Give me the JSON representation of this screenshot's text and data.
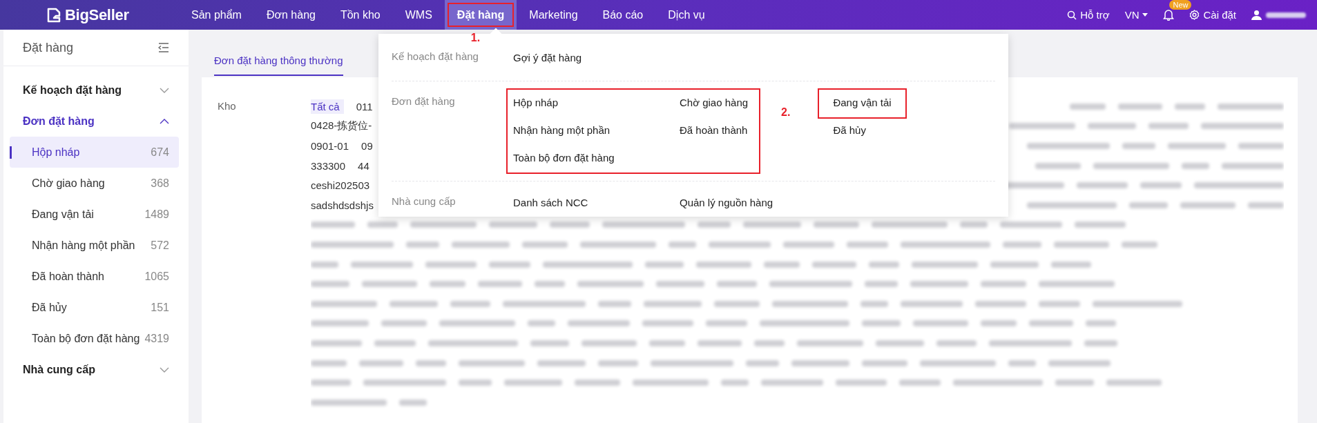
{
  "top_nav": {
    "logo": "BigSeller",
    "items": [
      {
        "label": "Sản phẩm",
        "selected": false,
        "highlighted": false
      },
      {
        "label": "Đơn hàng",
        "selected": false,
        "highlighted": false
      },
      {
        "label": "Tồn kho",
        "selected": false,
        "highlighted": false
      },
      {
        "label": "WMS",
        "selected": false,
        "highlighted": false
      },
      {
        "label": "Đặt hàng",
        "selected": true,
        "highlighted": true,
        "annotation": "1."
      },
      {
        "label": "Marketing",
        "selected": false,
        "highlighted": false
      },
      {
        "label": "Báo cáo",
        "selected": false,
        "highlighted": false
      },
      {
        "label": "Dịch vụ",
        "selected": false,
        "highlighted": false
      }
    ],
    "help": "Hỗ trợ",
    "language": "VN",
    "notification_badge": "New",
    "settings": "Cài đặt"
  },
  "sidebar": {
    "title": "Đặt hàng",
    "sections": [
      {
        "label": "Kế hoạch đặt hàng",
        "expanded": false
      },
      {
        "label": "Đơn đặt hàng",
        "expanded": true,
        "children": [
          {
            "label": "Hộp nháp",
            "count": "674",
            "selected": true
          },
          {
            "label": "Chờ giao hàng",
            "count": "368",
            "selected": false
          },
          {
            "label": "Đang vận tải",
            "count": "1489",
            "selected": false
          },
          {
            "label": "Nhận hàng một phần",
            "count": "572",
            "selected": false
          },
          {
            "label": "Đã hoàn thành",
            "count": "1065",
            "selected": false
          },
          {
            "label": "Đã hủy",
            "count": "151",
            "selected": false
          },
          {
            "label": "Toàn bộ đơn đặt hàng",
            "count": "4319",
            "selected": false
          }
        ]
      },
      {
        "label": "Nhà cung cấp",
        "expanded": false
      }
    ]
  },
  "tabs": [
    {
      "label": "Đơn đặt hàng thông thường",
      "selected": true
    }
  ],
  "warehouse_filter": {
    "label": "Kho",
    "rows": [
      {
        "options": [
          {
            "text": "Tất cả",
            "selected": true
          },
          {
            "text": "011",
            "selected": false
          }
        ]
      },
      {
        "options": [
          {
            "text": "0428-拣货位-",
            "selected": false
          }
        ]
      },
      {
        "options": [
          {
            "text": "0901-01",
            "selected": false
          },
          {
            "text": "09",
            "selected": false
          }
        ]
      },
      {
        "options": [
          {
            "text": "333300",
            "selected": false
          },
          {
            "text": "44",
            "selected": false
          }
        ]
      },
      {
        "options": [
          {
            "text": "ceshi202503",
            "selected": false
          }
        ]
      },
      {
        "options": [
          {
            "text": "sadshdsdshjs",
            "selected": false
          }
        ]
      }
    ]
  },
  "dropdown": {
    "annotation": "2.",
    "sections": [
      {
        "label": "Kế hoạch đặt hàng",
        "groups": [
          {
            "highlighted": false,
            "columns": [
              [
                {
                  "label": "Gợi ý đặt hàng",
                  "highlighted": false
                }
              ]
            ]
          }
        ]
      },
      {
        "label": "Đơn đặt hàng",
        "groups": [
          {
            "highlighted": true,
            "columns": [
              [
                {
                  "label": "Hộp nháp",
                  "highlighted": false
                },
                {
                  "label": "Nhận hàng một phần",
                  "highlighted": false
                },
                {
                  "label": "Toàn bộ đơn đặt hàng",
                  "highlighted": false
                }
              ],
              [
                {
                  "label": "Chờ giao hàng",
                  "highlighted": false
                },
                {
                  "label": "Đã hoàn thành",
                  "highlighted": false
                }
              ]
            ]
          },
          {
            "highlighted": false,
            "columns": [
              [
                {
                  "label": "Đang vận tải",
                  "highlighted": true
                },
                {
                  "label": "Đã hủy",
                  "highlighted": false
                }
              ]
            ]
          }
        ]
      },
      {
        "label": "Nhà cung cấp",
        "groups": [
          {
            "highlighted": false,
            "columns": [
              [
                {
                  "label": "Danh sách NCC",
                  "highlighted": false
                }
              ],
              [
                {
                  "label": "Quản lý nguồn hàng",
                  "highlighted": false
                }
              ]
            ]
          }
        ]
      }
    ]
  }
}
